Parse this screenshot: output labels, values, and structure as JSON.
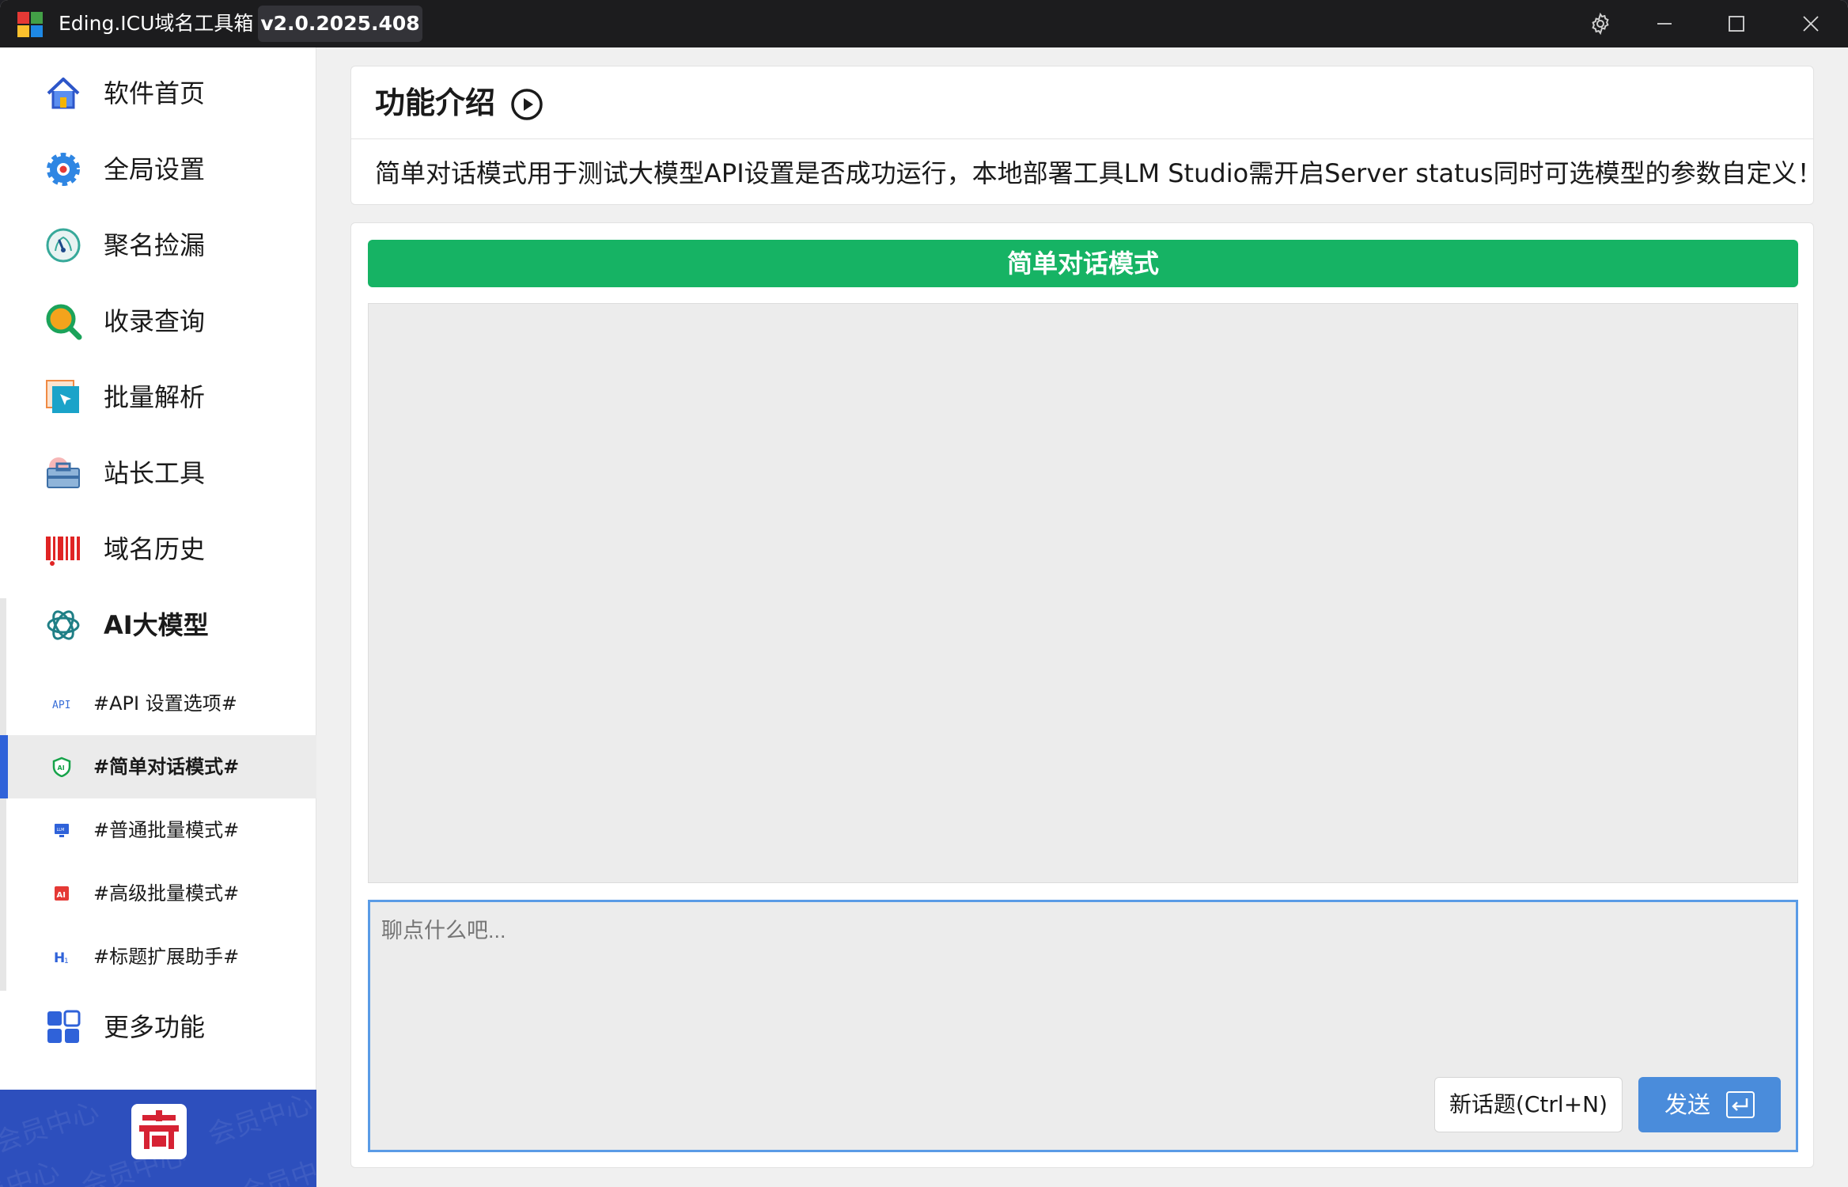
{
  "titlebar": {
    "app_title": "Eding.ICU域名工具箱",
    "version": "v2.0.2025.408",
    "logo_colors": [
      "#e53935",
      "#43a047",
      "#1e88e5",
      "#fbc02d"
    ]
  },
  "sidebar": {
    "items": [
      {
        "label": "软件首页",
        "icon": "home-icon"
      },
      {
        "label": "全局设置",
        "icon": "gear-icon"
      },
      {
        "label": "聚名捡漏",
        "icon": "dashboard-icon"
      },
      {
        "label": "收录查询",
        "icon": "search-icon"
      },
      {
        "label": "批量解析",
        "icon": "cursor-icon"
      },
      {
        "label": "站长工具",
        "icon": "toolbox-icon"
      },
      {
        "label": "域名历史",
        "icon": "barcode-icon"
      },
      {
        "label": "AI大模型",
        "icon": "openai-icon"
      }
    ],
    "subitems": [
      {
        "label": "#API 设置选项#",
        "icon": "api-icon",
        "active": false
      },
      {
        "label": "#简单对话模式#",
        "icon": "ai-shield-icon",
        "active": true
      },
      {
        "label": "#普通批量模式#",
        "icon": "llm-monitor-icon",
        "active": false
      },
      {
        "label": "#高级批量模式#",
        "icon": "ai-badge-icon",
        "active": false
      },
      {
        "label": "#标题扩展助手#",
        "icon": "heading-icon",
        "active": false
      }
    ],
    "more": {
      "label": "更多功能",
      "icon": "grid-icon"
    },
    "member": {
      "watermark": "会员中心",
      "logo": "member-logo"
    }
  },
  "intro": {
    "title": "功能介绍",
    "text": "简单对话模式用于测试大模型API设置是否成功运行，本地部署工具LM Studio需开启Server status同时可选模型的参数自定义！"
  },
  "chat": {
    "mode_title": "简单对话模式",
    "input_placeholder": "聊点什么吧...",
    "new_topic_label": "新话题(Ctrl+N)",
    "send_label": "发送"
  },
  "colors": {
    "accent": "#16b364",
    "primary": "#4a8cdb",
    "active_indicator": "#2f62d9",
    "banner": "#2d4fbd"
  }
}
